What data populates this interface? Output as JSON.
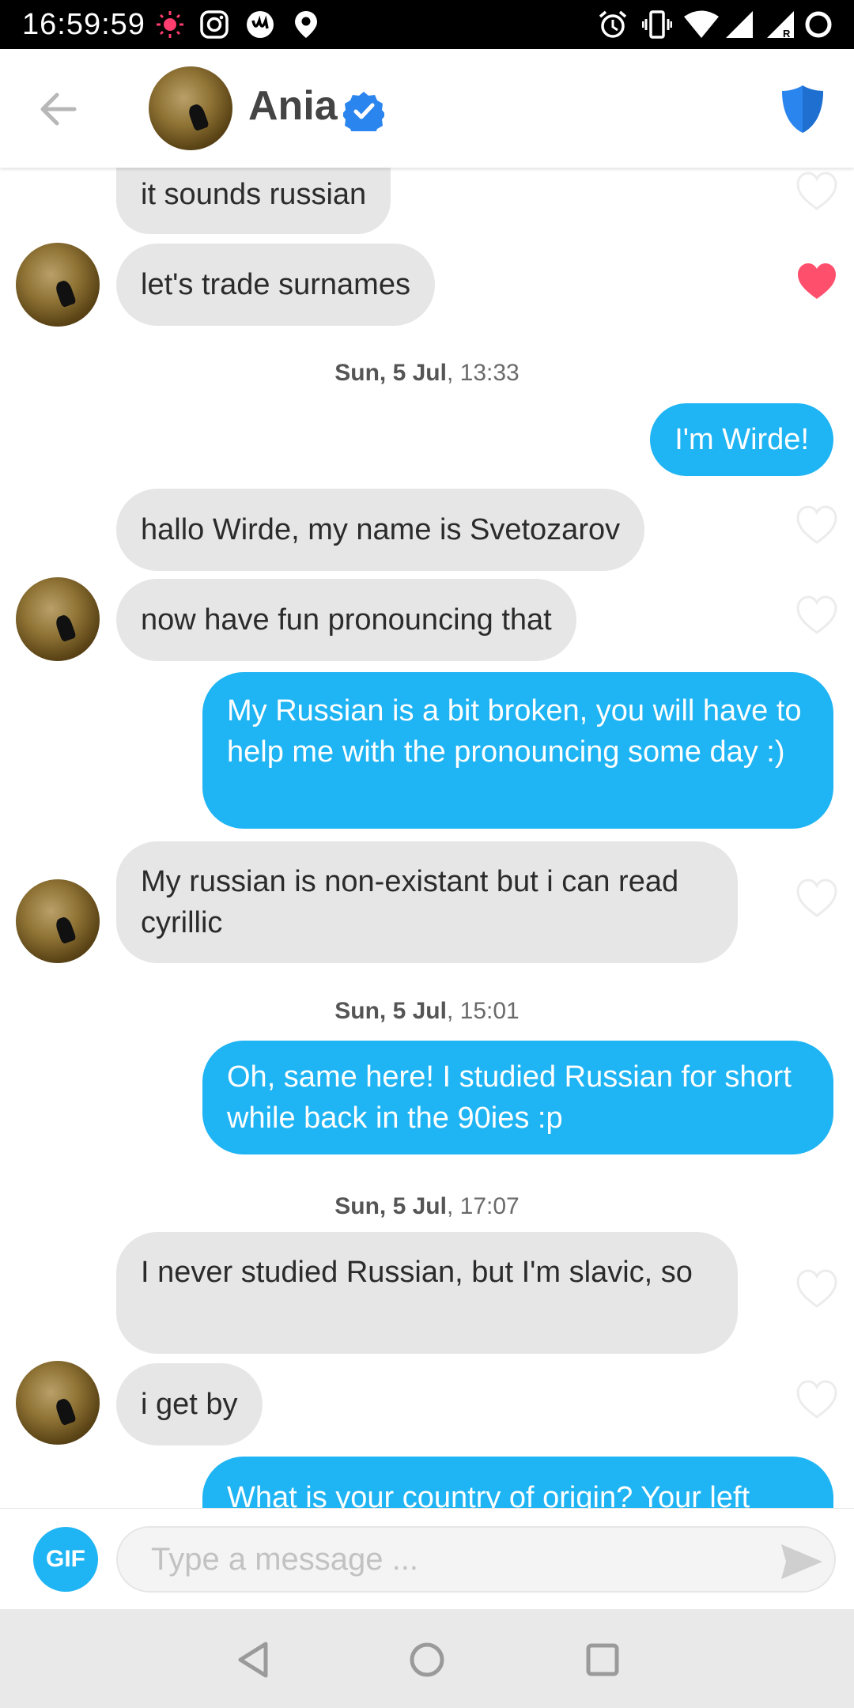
{
  "status_bar": {
    "time": "16:59:59",
    "icons": [
      "notification-dot-icon",
      "instagram-icon",
      "app-icon",
      "location-icon",
      "alarm-icon",
      "vibrate-icon",
      "wifi-icon",
      "signal-icon",
      "signal-roaming-icon",
      "battery-icon"
    ]
  },
  "header": {
    "name": "Ania",
    "verified": true,
    "colors": {
      "verified": "#2a85ef",
      "shield": "#2a85ef"
    }
  },
  "messages": [
    {
      "type": "in",
      "text": "it sounds russian",
      "liked": false
    },
    {
      "type": "in",
      "text": "let's trade surnames",
      "liked": true
    },
    {
      "type": "timestamp",
      "day": "Sun, 5 Jul",
      "time": ", 13:33"
    },
    {
      "type": "out",
      "text": "I'm Wirde!"
    },
    {
      "type": "in",
      "text": "hallo Wirde, my name is Svetozarov",
      "liked": false
    },
    {
      "type": "in",
      "text": "now have fun pronouncing that",
      "liked": false
    },
    {
      "type": "out",
      "text": "My Russian is a bit broken, you will have to help me with the pronouncing some day :)"
    },
    {
      "type": "in",
      "text": "My russian is non-existant but i can read cyrillic",
      "liked": false
    },
    {
      "type": "timestamp",
      "day": "Sun, 5 Jul",
      "time": ", 15:01"
    },
    {
      "type": "out",
      "text": "Oh, same here! I studied Russian for short while back in the 90ies :p"
    },
    {
      "type": "timestamp",
      "day": "Sun, 5 Jul",
      "time": ", 17:07"
    },
    {
      "type": "in",
      "text": "I never studied Russian, but I'm slavic, so",
      "liked": false
    },
    {
      "type": "in",
      "text": "i get by",
      "liked": false
    },
    {
      "type": "out",
      "text": "What is your country of origin? Your left"
    }
  ],
  "composer": {
    "gif_label": "GIF",
    "placeholder": "Type a message ..."
  },
  "colors": {
    "accent": "#1fb4f3",
    "incoming_bubble": "#e6e6e6",
    "liked_heart": "#fe4f6d"
  }
}
